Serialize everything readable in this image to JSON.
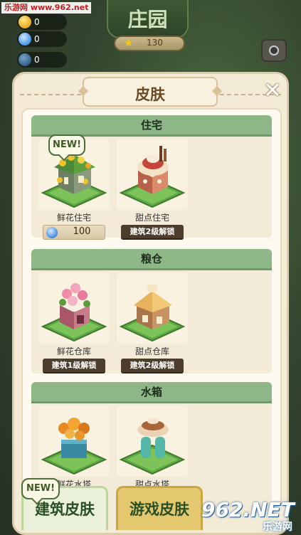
{
  "watermark_top": "乐游网 www.962.net",
  "hud": {
    "gold": "0",
    "gems": "0",
    "other": "0",
    "star_value": "130"
  },
  "farm_title": "庄园",
  "dialog": {
    "title": "皮肤",
    "close": "✕"
  },
  "sections": [
    {
      "title": "住宅",
      "items": [
        {
          "name": "鲜花住宅",
          "price": "100",
          "new_badge": "NEW!"
        },
        {
          "name": "甜点住宅",
          "lock": "建筑2级解锁"
        }
      ]
    },
    {
      "title": "粮仓",
      "items": [
        {
          "name": "鲜花仓库",
          "lock": "建筑1级解锁"
        },
        {
          "name": "甜点仓库",
          "lock": "建筑2级解锁"
        }
      ]
    },
    {
      "title": "水箱",
      "items": [
        {
          "name": "鲜花水塔"
        },
        {
          "name": "甜点水塔"
        }
      ]
    }
  ],
  "tabs": {
    "new_badge": "NEW!",
    "building_skin": "建筑皮肤",
    "game_skin": "游戏皮肤"
  },
  "watermark_bottom": {
    "big": "962.NET",
    "small": "乐游网"
  }
}
